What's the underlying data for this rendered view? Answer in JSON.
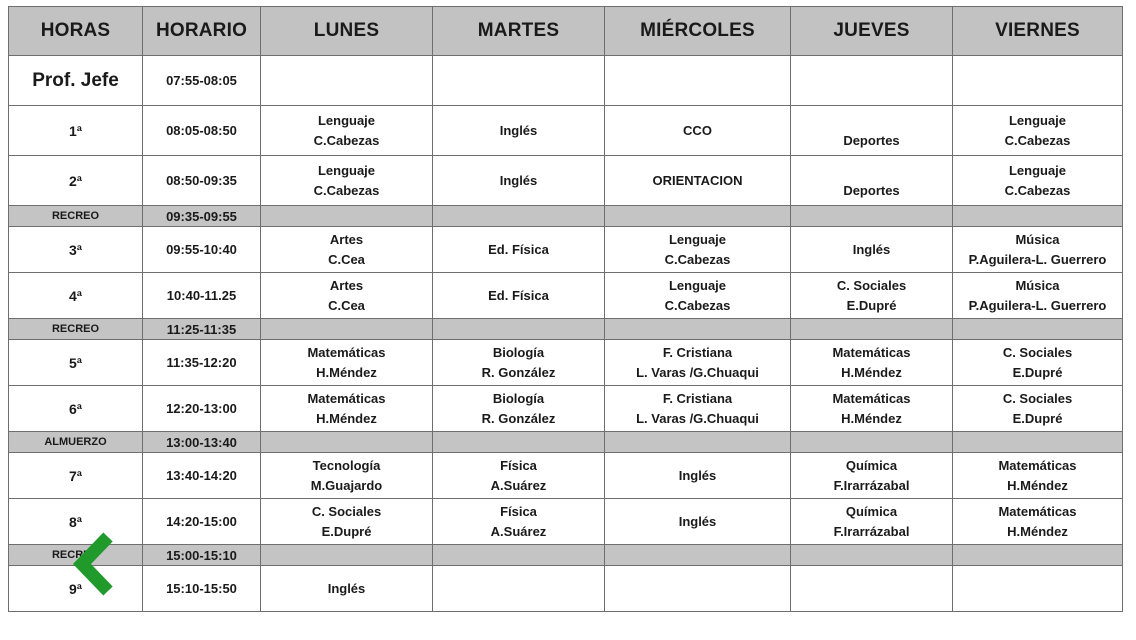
{
  "headers": [
    "HORAS",
    "HORARIO",
    "LUNES",
    "MARTES",
    "MIÉRCOLES",
    "JUEVES",
    "VIERNES"
  ],
  "rows": [
    {
      "hour": "Prof. Jefe",
      "time": "07:55-08:05",
      "cells": [
        [],
        [],
        [],
        [],
        []
      ]
    },
    {
      "hour": "1ª",
      "time": "08:05-08:50",
      "cells": [
        [
          "Lenguaje",
          "C.Cabezas"
        ],
        [
          "Inglés"
        ],
        [
          "CCO"
        ],
        [
          "Deportes"
        ],
        [
          "Lenguaje",
          "C.Cabezas"
        ]
      ]
    },
    {
      "hour": "2ª",
      "time": "08:50-09:35",
      "cells": [
        [
          "Lenguaje",
          "C.Cabezas"
        ],
        [
          "Inglés"
        ],
        [
          "ORIENTACION"
        ],
        [
          "Deportes"
        ],
        [
          "Lenguaje",
          "C.Cabezas"
        ]
      ]
    },
    {
      "hour": "RECREO",
      "time": "09:35-09:55",
      "break": true
    },
    {
      "hour": "3ª",
      "time": "09:55-10:40",
      "cells": [
        [
          "Artes",
          "C.Cea"
        ],
        [
          "Ed. Física"
        ],
        [
          "Lenguaje",
          "C.Cabezas"
        ],
        [
          "Inglés"
        ],
        [
          "Música",
          "P.Aguilera-L. Guerrero"
        ]
      ]
    },
    {
      "hour": "4ª",
      "time": "10:40-11.25",
      "cells": [
        [
          "Artes",
          "C.Cea"
        ],
        [
          "Ed. Física"
        ],
        [
          "Lenguaje",
          "C.Cabezas"
        ],
        [
          "C. Sociales",
          "E.Dupré"
        ],
        [
          "Música",
          "P.Aguilera-L. Guerrero"
        ]
      ]
    },
    {
      "hour": "RECREO",
      "time": "11:25-11:35",
      "break": true
    },
    {
      "hour": "5ª",
      "time": "11:35-12:20",
      "cells": [
        [
          "Matemáticas",
          "H.Méndez"
        ],
        [
          "Biología",
          "R. González"
        ],
        [
          "F. Cristiana",
          "L. Varas /G.Chuaqui"
        ],
        [
          "Matemáticas",
          "H.Méndez"
        ],
        [
          "C. Sociales",
          "E.Dupré"
        ]
      ]
    },
    {
      "hour": "6ª",
      "time": "12:20-13:00",
      "cells": [
        [
          "Matemáticas",
          "H.Méndez"
        ],
        [
          "Biología",
          "R. González"
        ],
        [
          "F. Cristiana",
          "L. Varas /G.Chuaqui"
        ],
        [
          "Matemáticas",
          "H.Méndez"
        ],
        [
          "C. Sociales",
          "E.Dupré"
        ]
      ]
    },
    {
      "hour": "ALMUERZO",
      "time": "13:00-13:40",
      "break": true
    },
    {
      "hour": "7ª",
      "time": "13:40-14:20",
      "cells": [
        [
          "Tecnología",
          "M.Guajardo"
        ],
        [
          "Física",
          "A.Suárez"
        ],
        [
          "Inglés"
        ],
        [
          "Química",
          "F.Irarrázabal"
        ],
        [
          "Matemáticas",
          "H.Méndez"
        ]
      ]
    },
    {
      "hour": "8ª",
      "time": "14:20-15:00",
      "cells": [
        [
          "C. Sociales",
          "E.Dupré"
        ],
        [
          "Física",
          "A.Suárez"
        ],
        [
          "Inglés"
        ],
        [
          "Química",
          "F.Irarrázabal"
        ],
        [
          "Matemáticas",
          "H.Méndez"
        ]
      ]
    },
    {
      "hour": "RECREO",
      "time": "15:00-15:10",
      "break": true
    },
    {
      "hour": "9ª",
      "time": "15:10-15:50",
      "cells": [
        [
          "Inglés"
        ],
        [],
        [],
        [],
        []
      ]
    }
  ],
  "overlay": {
    "icon": "chevron-left-icon",
    "color": "#1f9a2b"
  }
}
